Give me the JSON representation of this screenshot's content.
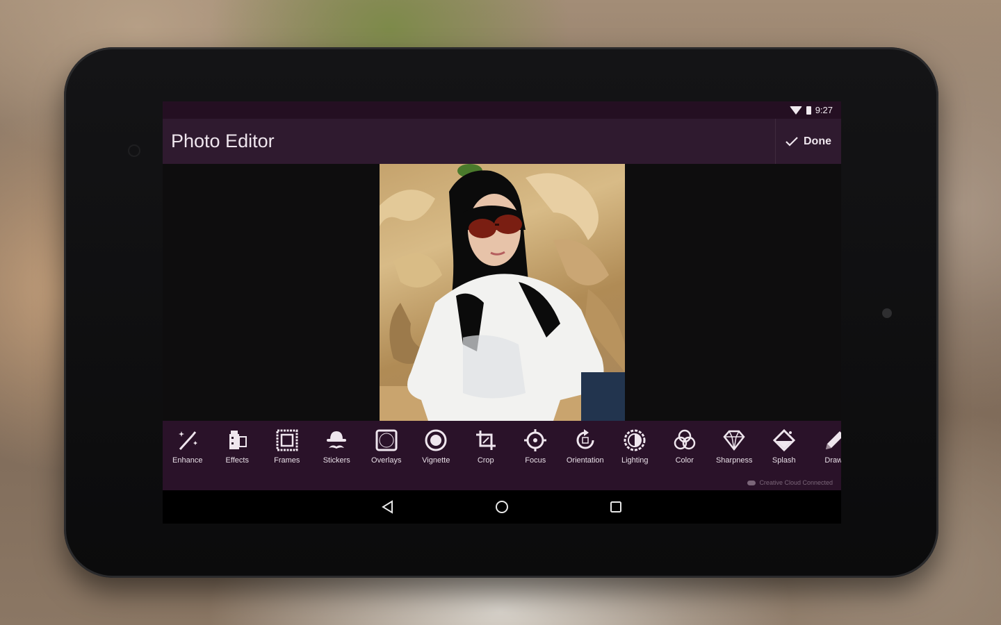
{
  "status_bar": {
    "time": "9:27"
  },
  "action_bar": {
    "title": "Photo Editor",
    "done_label": "Done"
  },
  "tools": [
    {
      "label": "Enhance",
      "icon": "magic-wand-icon"
    },
    {
      "label": "Effects",
      "icon": "film-strip-icon"
    },
    {
      "label": "Frames",
      "icon": "frame-icon"
    },
    {
      "label": "Stickers",
      "icon": "hat-mustache-icon"
    },
    {
      "label": "Overlays",
      "icon": "overlay-icon"
    },
    {
      "label": "Vignette",
      "icon": "vignette-icon"
    },
    {
      "label": "Crop",
      "icon": "crop-icon"
    },
    {
      "label": "Focus",
      "icon": "focus-icon"
    },
    {
      "label": "Orientation",
      "icon": "rotate-icon"
    },
    {
      "label": "Lighting",
      "icon": "lighting-icon"
    },
    {
      "label": "Color",
      "icon": "color-circles-icon"
    },
    {
      "label": "Sharpness",
      "icon": "diamond-icon"
    },
    {
      "label": "Splash",
      "icon": "splash-icon"
    },
    {
      "label": "Draw",
      "icon": "pencil-icon"
    }
  ],
  "footer": {
    "text": "Creative Cloud Connected"
  },
  "colors": {
    "status_bar": "#240f22",
    "action_bar": "#2f1a2f",
    "toolbar": "#2a1229",
    "text": "#efe6ee"
  }
}
